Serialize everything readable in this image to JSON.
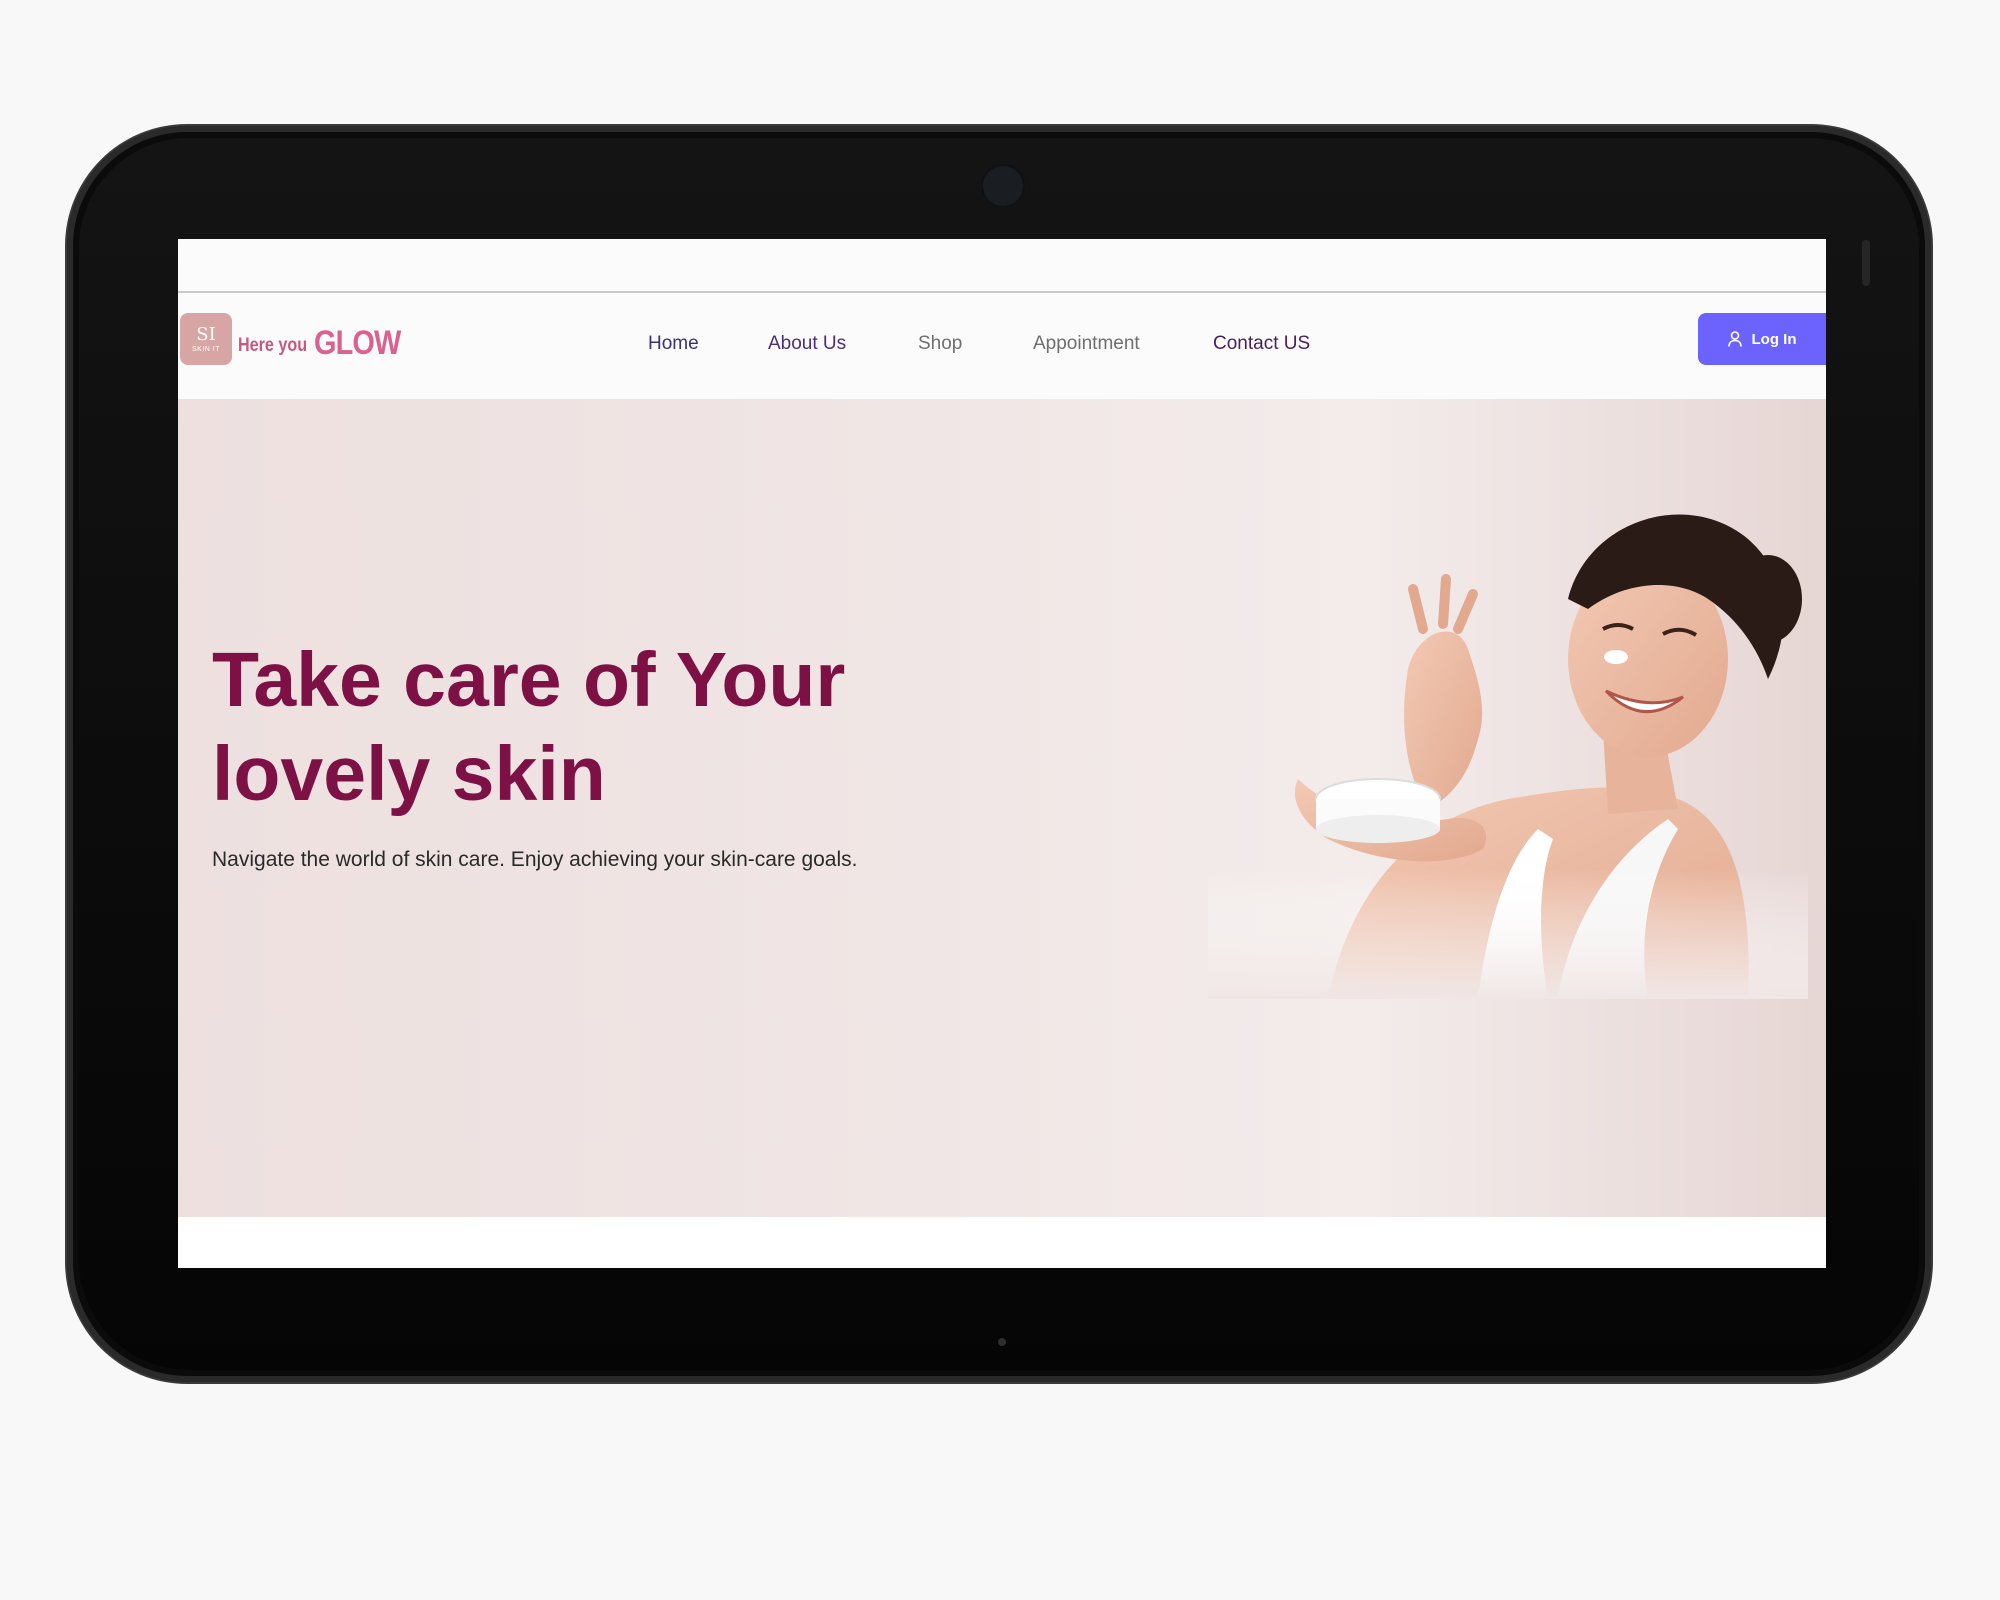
{
  "brand": {
    "badge_mark": "SI",
    "badge_text": "SKIN IT",
    "tagline_part1": "Here you",
    "tagline_part2": "GLOW",
    "colors": {
      "tagline": "#c8577f",
      "badge": "#d7a5a3"
    }
  },
  "nav": {
    "items": [
      {
        "label": "Home",
        "color": "#3d2f7a"
      },
      {
        "label": "About Us",
        "color": "#4a2f7a"
      },
      {
        "label": "Shop",
        "color": "#6f6f6f"
      },
      {
        "label": "Appointment",
        "color": "#6f6f6f"
      },
      {
        "label": "Contact US",
        "color": "#4a1f5e"
      }
    ],
    "login_label": "Log In",
    "login_icon": "user-icon",
    "login_color": "#6c63ff"
  },
  "hero": {
    "title_line1": "Take care of Your",
    "title_line2": "lovely skin",
    "subtitle": "Navigate the world of skin care. Enjoy achieving your skin-care goals.",
    "title_color": "#7d1145"
  }
}
